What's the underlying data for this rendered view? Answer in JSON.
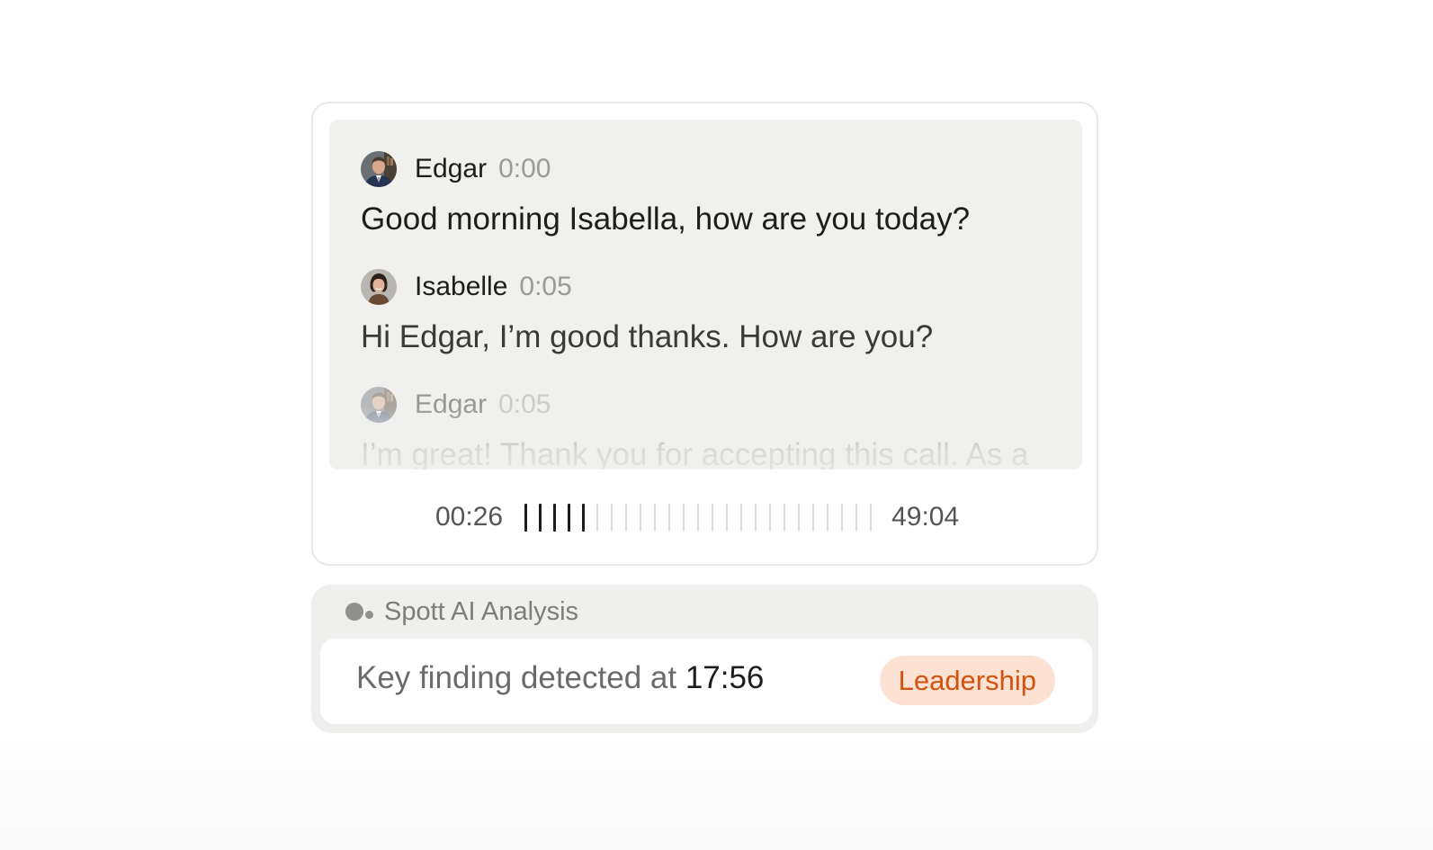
{
  "transcript": {
    "messages": [
      {
        "speaker": "Edgar",
        "time": "0:00",
        "text": "Good morning Isabella, how are you today?",
        "avatar_icon": "man-portrait-avatar"
      },
      {
        "speaker": "Isabelle",
        "time": "0:05",
        "text": "Hi Edgar, I’m good thanks. How are you?",
        "avatar_icon": "woman-portrait-avatar"
      },
      {
        "speaker": "Edgar",
        "time": "0:05",
        "text": "I’m great! Thank you for accepting this call. As a",
        "avatar_icon": "man-portrait-avatar"
      }
    ]
  },
  "player": {
    "current_time": "00:26",
    "total_time": "49:04",
    "bars_total": 25,
    "bars_played": 5
  },
  "analysis": {
    "title": "Spott AI Analysis",
    "icon": "ai-dots-icon",
    "finding_prefix": "Key finding detected at ",
    "finding_time": "17:56",
    "tag": "Leadership"
  },
  "colors": {
    "panel_bg": "#f0f0ee",
    "tag_bg": "#fde2d3",
    "tag_text": "#d4520f",
    "played_bar": "#1d1d1b",
    "unplayed_bar": "#dcdcda"
  }
}
